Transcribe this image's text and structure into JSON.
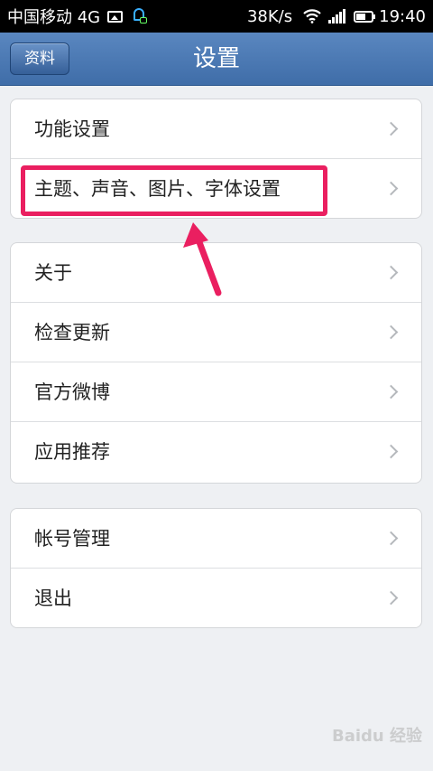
{
  "status_bar": {
    "carrier": "中国移动 4G",
    "speed": "38K/s",
    "time": "19:40",
    "icons": [
      "picture-icon",
      "headset-icon",
      "wifi-icon",
      "signal-icon",
      "battery-icon"
    ]
  },
  "header": {
    "back_label": "资料",
    "title": "设置"
  },
  "groups": [
    {
      "rows": [
        "功能设置",
        "主题、声音、图片、字体设置"
      ]
    },
    {
      "rows": [
        "关于",
        "检查更新",
        "官方微博",
        "应用推荐"
      ]
    },
    {
      "rows": [
        "帐号管理",
        "退出"
      ]
    }
  ],
  "annotation": {
    "color": "#ea1f60"
  },
  "watermark": "Baidu 经验",
  "colors": {
    "header": "#4a78b2",
    "background": "#eef0f3",
    "accent": "#ea1f60"
  }
}
